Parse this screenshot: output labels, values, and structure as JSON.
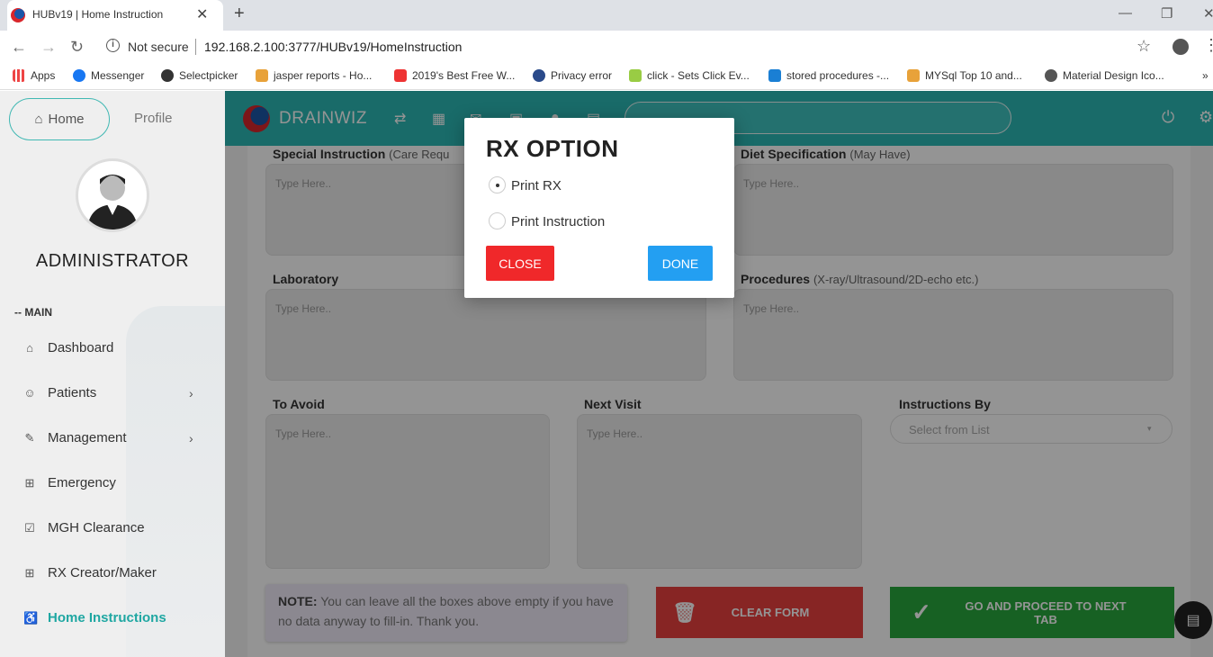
{
  "browser": {
    "tab_title": "HUBv19 | Home Instruction",
    "not_secure": "Not secure",
    "url": "192.168.2.100:3777/HUBv19/HomeInstruction",
    "bookmarks": [
      "Apps",
      "Messenger",
      "Selectpicker",
      "jasper reports - Ho...",
      "2019's Best Free W...",
      "Privacy error",
      "click - Sets Click Ev...",
      "stored procedures -...",
      "MYSql Top 10 and...",
      "Material Design Ico..."
    ]
  },
  "sidebar": {
    "home_label": "Home",
    "profile_label": "Profile",
    "user_name": "ADMINISTRATOR",
    "section_label": "-- MAIN",
    "items": [
      {
        "label": "Dashboard",
        "icon": "home-icon"
      },
      {
        "label": "Patients",
        "icon": "face-icon"
      },
      {
        "label": "Management",
        "icon": "wrench-icon"
      },
      {
        "label": "Emergency",
        "icon": "plus-box-icon"
      },
      {
        "label": "MGH Clearance",
        "icon": "checkbox-icon"
      },
      {
        "label": "RX Creator/Maker",
        "icon": "grid-plus-icon"
      },
      {
        "label": "Home Instructions",
        "icon": "walk-icon",
        "active": true
      }
    ]
  },
  "topnav": {
    "brand": "DRAINWIZ"
  },
  "form": {
    "special_instruction": {
      "label": "Special Instruction",
      "hint": "(Care Requ",
      "placeholder": "Type Here.."
    },
    "diet_specification": {
      "label": "Diet Specification",
      "hint": "(May Have)",
      "placeholder": "Type Here.."
    },
    "laboratory": {
      "label": "Laboratory",
      "placeholder": "Type Here.."
    },
    "procedures": {
      "label": "Procedures",
      "hint": "(X-ray/Ultrasound/2D-echo etc.)",
      "placeholder": "Type Here.."
    },
    "to_avoid": {
      "label": "To Avoid",
      "placeholder": "Type Here.."
    },
    "next_visit": {
      "label": "Next Visit",
      "placeholder": "Type Here.."
    },
    "instructions_by": {
      "label": "Instructions By",
      "placeholder": "Select from List"
    }
  },
  "note": {
    "bold": "NOTE:",
    "text": " You can leave all the boxes above empty if you have no data anyway to fill-in. Thank you."
  },
  "buttons": {
    "clear": "CLEAR FORM",
    "proceed": "GO AND PROCEED TO NEXT TAB"
  },
  "modal": {
    "title": "RX OPTION",
    "options": [
      {
        "label": "Print RX",
        "selected": true
      },
      {
        "label": "Print Instruction",
        "selected": false
      }
    ],
    "close": "CLOSE",
    "done": "DONE"
  },
  "colors": {
    "teal": "#2cb9b5",
    "danger": "#f0282a",
    "primary": "#239ff2",
    "success": "#29a83d"
  }
}
